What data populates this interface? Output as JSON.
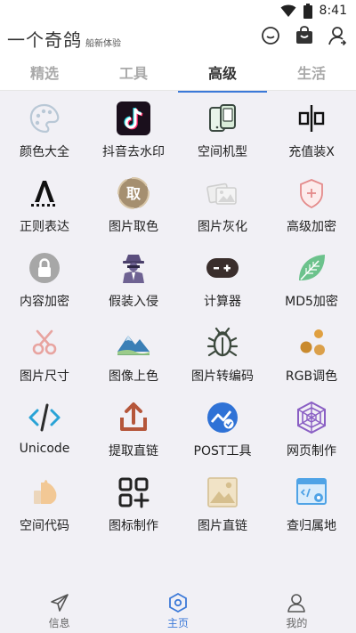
{
  "status": {
    "time": "8:41"
  },
  "app": {
    "title": "一个奇鸽",
    "subtitle": "船新体验"
  },
  "header_icons": [
    "chat-icon",
    "bag-icon",
    "user-icon"
  ],
  "tabs": [
    {
      "label": "精选",
      "active": false
    },
    {
      "label": "工具",
      "active": false
    },
    {
      "label": "高级",
      "active": true
    },
    {
      "label": "生活",
      "active": false
    }
  ],
  "grid_items": [
    {
      "label": "颜色大全",
      "icon": "palette-icon"
    },
    {
      "label": "抖音去水印",
      "icon": "tiktok-icon"
    },
    {
      "label": "空间机型",
      "icon": "phone-icon"
    },
    {
      "label": "充值装X",
      "icon": "recharge-icon"
    },
    {
      "label": "正则表达",
      "icon": "regex-icon"
    },
    {
      "label": "图片取色",
      "icon": "color-pick-icon"
    },
    {
      "label": "图片灰化",
      "icon": "gray-image-icon"
    },
    {
      "label": "高级加密",
      "icon": "shield-icon"
    },
    {
      "label": "内容加密",
      "icon": "lock-icon"
    },
    {
      "label": "假装入侵",
      "icon": "hacker-icon"
    },
    {
      "label": "计算器",
      "icon": "calculator-icon"
    },
    {
      "label": "MD5加密",
      "icon": "leaf-icon"
    },
    {
      "label": "图片尺寸",
      "icon": "scissors-icon"
    },
    {
      "label": "图像上色",
      "icon": "mountain-icon"
    },
    {
      "label": "图片转编码",
      "icon": "bug-icon"
    },
    {
      "label": "RGB调色",
      "icon": "dots-icon"
    },
    {
      "label": "Unicode",
      "icon": "code-icon"
    },
    {
      "label": "提取直链",
      "icon": "share-icon"
    },
    {
      "label": "POST工具",
      "icon": "chart-circle-icon"
    },
    {
      "label": "网页制作",
      "icon": "web-icon"
    },
    {
      "label": "空间代码",
      "icon": "thumb-icon"
    },
    {
      "label": "图标制作",
      "icon": "grid-plus-icon"
    },
    {
      "label": "图片直链",
      "icon": "image-icon"
    },
    {
      "label": "查归属地",
      "icon": "window-code-icon"
    }
  ],
  "bottom_nav": [
    {
      "label": "信息",
      "icon": "send-icon",
      "active": false
    },
    {
      "label": "主页",
      "icon": "home-hex-icon",
      "active": true
    },
    {
      "label": "我的",
      "icon": "profile-icon",
      "active": false
    }
  ],
  "colors": {
    "accent": "#3b79d8",
    "background": "#f1f0f5"
  }
}
